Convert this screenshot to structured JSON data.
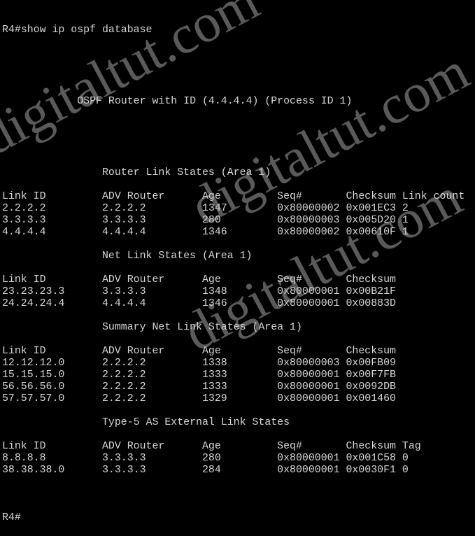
{
  "terminal": {
    "command_prompt": "R4#",
    "command": "show ip ospf database",
    "header": "OSPF Router with ID (4.4.4.4) (Process ID 1)",
    "final_prompt": "R4#",
    "sections": [
      {
        "title": "Router Link States (Area 1)",
        "columns": [
          "Link ID",
          "ADV Router",
          "Age",
          "Seq#",
          "Checksum",
          "Link count"
        ],
        "rows": [
          [
            "2.2.2.2",
            "2.2.2.2",
            "1347",
            "0x80000002",
            "0x001EC3",
            "2"
          ],
          [
            "3.3.3.3",
            "3.3.3.3",
            "280",
            "0x80000003",
            "0x005D20",
            "1"
          ],
          [
            "4.4.4.4",
            "4.4.4.4",
            "1346",
            "0x80000002",
            "0x00610F",
            "1"
          ]
        ]
      },
      {
        "title": "Net Link States (Area 1)",
        "columns": [
          "Link ID",
          "ADV Router",
          "Age",
          "Seq#",
          "Checksum"
        ],
        "rows": [
          [
            "23.23.23.3",
            "3.3.3.3",
            "1348",
            "0x80000001",
            "0x00B21F"
          ],
          [
            "24.24.24.4",
            "4.4.4.4",
            "1346",
            "0x80000001",
            "0x00883D"
          ]
        ]
      },
      {
        "title": "Summary Net Link States (Area 1)",
        "columns": [
          "Link ID",
          "ADV Router",
          "Age",
          "Seq#",
          "Checksum"
        ],
        "rows": [
          [
            "12.12.12.0",
            "2.2.2.2",
            "1338",
            "0x80000003",
            "0x00FB09"
          ],
          [
            "15.15.15.0",
            "2.2.2.2",
            "1333",
            "0x80000001",
            "0x00F7FB"
          ],
          [
            "56.56.56.0",
            "2.2.2.2",
            "1333",
            "0x80000001",
            "0x0092DB"
          ],
          [
            "57.57.57.0",
            "2.2.2.2",
            "1329",
            "0x80000001",
            "0x001460"
          ]
        ]
      },
      {
        "title": "Type-5 AS External Link States",
        "columns": [
          "Link ID",
          "ADV Router",
          "Age",
          "Seq#",
          "Checksum",
          "Tag"
        ],
        "rows": [
          [
            "8.8.8.8",
            "3.3.3.3",
            "280",
            "0x80000001",
            "0x001C58",
            "0"
          ],
          [
            "38.38.38.0",
            "3.3.3.3",
            "284",
            "0x80000001",
            "0x0030F1",
            "0"
          ]
        ]
      }
    ]
  },
  "watermark": "digitaltut.com"
}
